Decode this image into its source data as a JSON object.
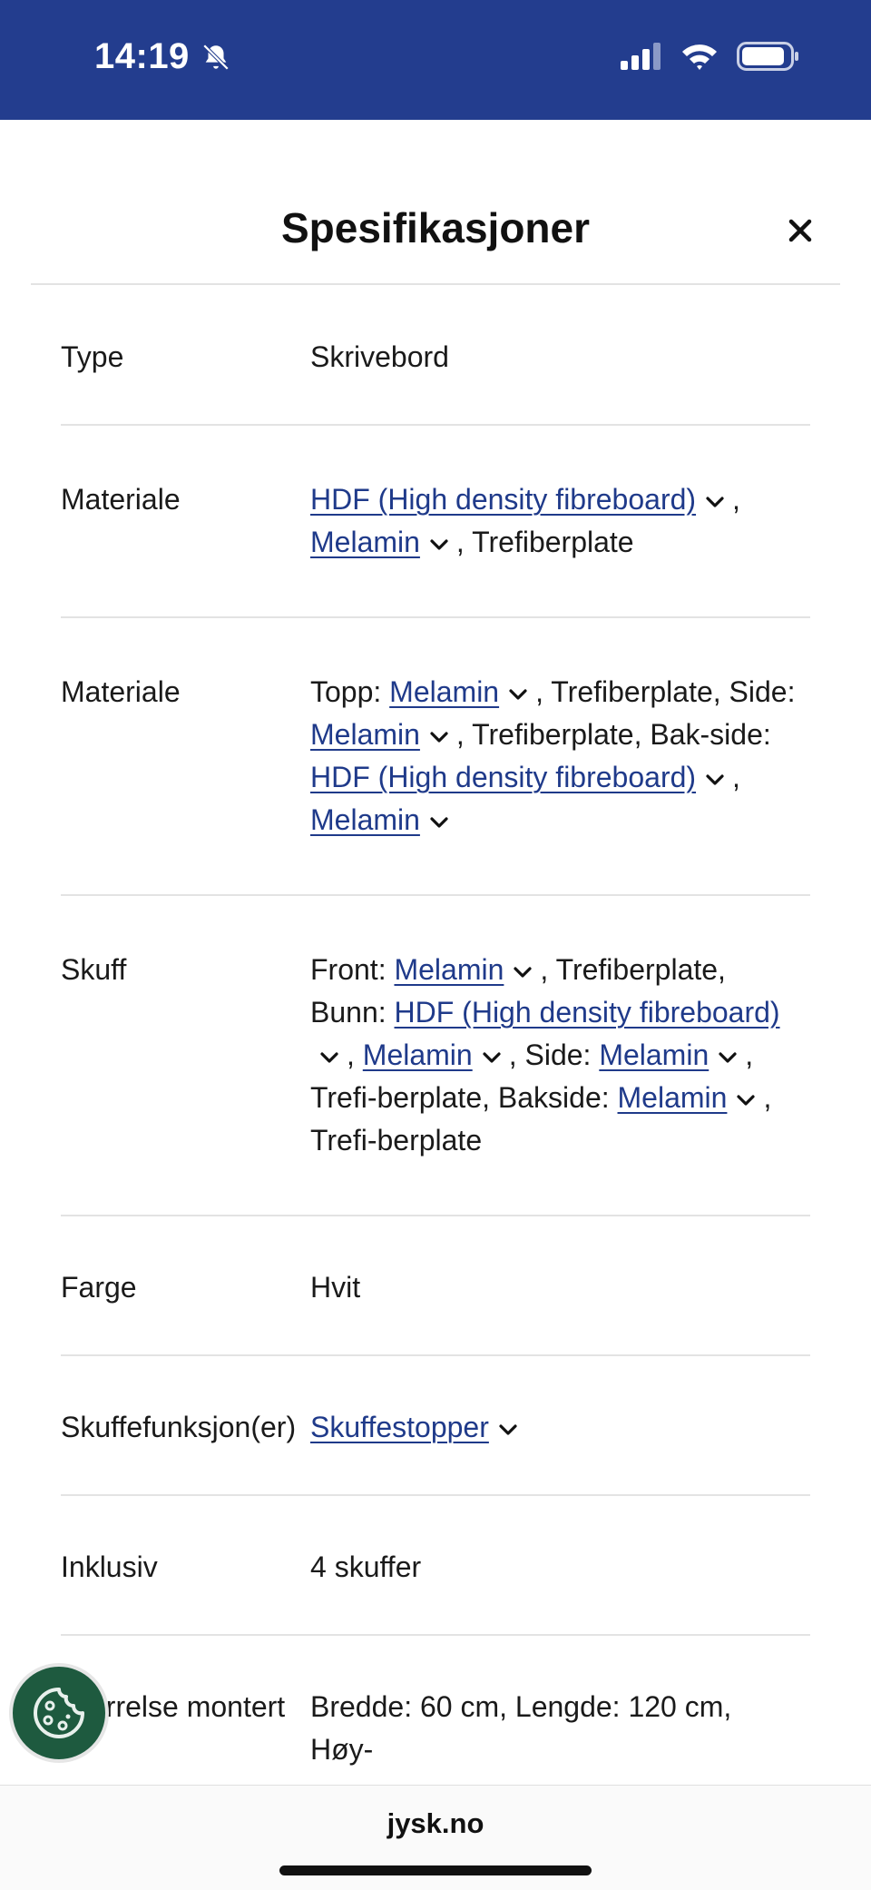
{
  "status_bar": {
    "time": "14:19",
    "icons": [
      "bell-slash-icon",
      "signal-icon",
      "wifi-icon",
      "battery-icon"
    ]
  },
  "sheet": {
    "title": "Spesifikasjoner",
    "close_icon": "close-icon"
  },
  "specs": [
    {
      "label": "Type",
      "value": [
        {
          "t": "Skrivebord"
        }
      ]
    },
    {
      "label": "Materiale",
      "value": [
        {
          "t": "HDF (High density fibreboard)",
          "link": true
        },
        {
          "t": ", "
        },
        {
          "t": "Melamin",
          "link": true
        },
        {
          "t": ", Trefiberplate"
        }
      ]
    },
    {
      "label": "Materiale",
      "value": [
        {
          "t": "Topp: "
        },
        {
          "t": "Melamin",
          "link": true
        },
        {
          "t": ", Trefiberplate, Side: "
        },
        {
          "t": "Melamin",
          "link": true
        },
        {
          "t": ", Trefiberplate, Bak-side: "
        },
        {
          "t": "HDF (High density fibreboard)",
          "link": true
        },
        {
          "t": ", "
        },
        {
          "t": "Melamin",
          "link": true
        }
      ]
    },
    {
      "label": "Skuff",
      "value": [
        {
          "t": "Front: "
        },
        {
          "t": "Melamin",
          "link": true
        },
        {
          "t": ", Trefiberplate, Bunn: "
        },
        {
          "t": "HDF (High density fibreboard)",
          "link": true
        },
        {
          "t": ", "
        },
        {
          "t": "Melamin",
          "link": true
        },
        {
          "t": ", Side: "
        },
        {
          "t": "Melamin",
          "link": true
        },
        {
          "t": ", Trefi-berplate, Bakside: "
        },
        {
          "t": "Melamin",
          "link": true
        },
        {
          "t": ", Trefi-berplate"
        }
      ]
    },
    {
      "label": "Farge",
      "value": [
        {
          "t": "Hvit"
        }
      ]
    },
    {
      "label": "Skuffefunksjon(er)",
      "value": [
        {
          "t": "Skuffestopper",
          "link": true
        }
      ]
    },
    {
      "label": "Inklusiv",
      "value": [
        {
          "t": "4 skuffer"
        }
      ]
    },
    {
      "label": "Størrelse montert",
      "value": [
        {
          "t": "Bredde: 60 cm, Lengde: 120 cm, Høy-"
        }
      ]
    }
  ],
  "cookie_button": {
    "icon": "cookie-icon"
  },
  "browser": {
    "domain": "jysk.no"
  }
}
